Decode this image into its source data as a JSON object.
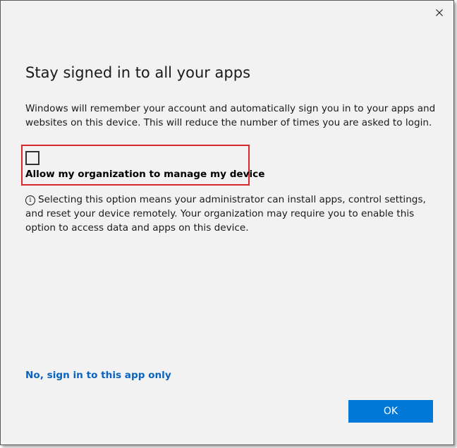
{
  "dialog": {
    "title": "Stay signed in to all your apps",
    "description": "Windows will remember your account and automatically sign you in to your apps and websites on this device. This will reduce the number of times you are asked to login.",
    "checkbox": {
      "label": "Allow my organization to manage my device",
      "checked": false
    },
    "info_icon_glyph": "i",
    "info_text": "Selecting this option means your administrator can install apps, control settings, and reset your device remotely. Your organization may require you to enable this option to access data and apps on this device.",
    "alt_link": "No, sign in to this app only",
    "ok_label": "OK"
  },
  "colors": {
    "accent": "#0078d7",
    "link": "#0a63bf",
    "highlight": "#d9272e",
    "background": "#f2f2f2"
  },
  "icons": {
    "close": "close-icon",
    "info": "info-icon"
  }
}
